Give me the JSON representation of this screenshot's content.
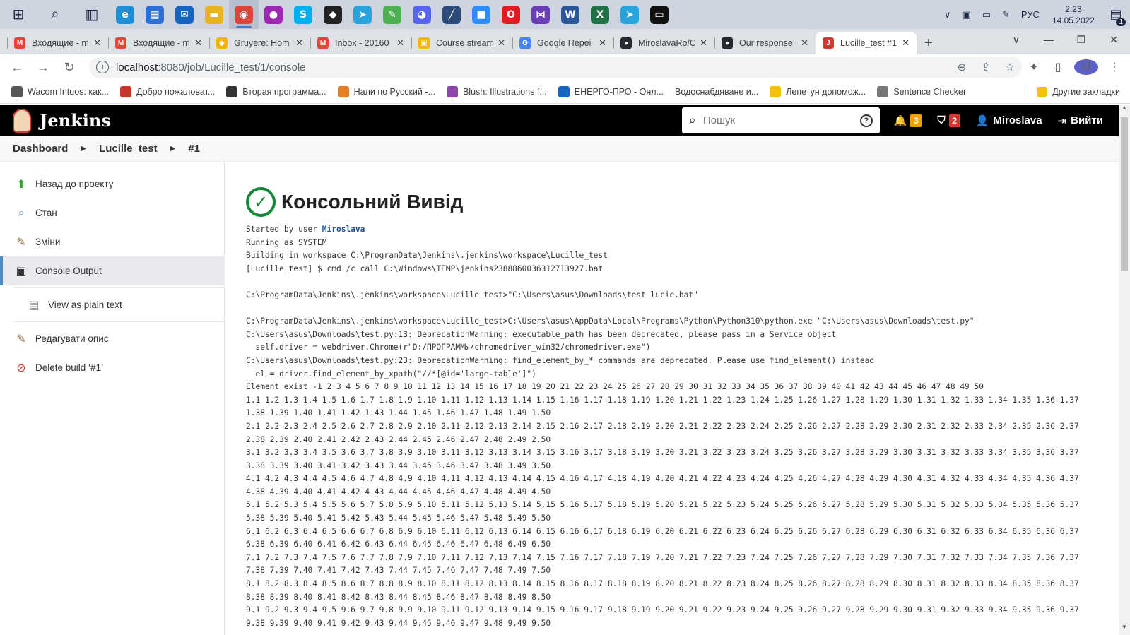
{
  "taskbar": {
    "lang": "РУС",
    "time": "2:23",
    "date": "14.05.2022",
    "notif_count": "1",
    "apps": [
      {
        "name": "edge-icon",
        "glyph": "e",
        "color": "#1e8fd6"
      },
      {
        "name": "store-icon",
        "glyph": "▦",
        "color": "#2d6fd6"
      },
      {
        "name": "mail-icon",
        "glyph": "✉",
        "color": "#1565c0"
      },
      {
        "name": "explorer-icon",
        "glyph": "▬",
        "color": "#e8b320"
      },
      {
        "name": "chrome-icon",
        "glyph": "◉",
        "color": "#db4437"
      },
      {
        "name": "paint-icon",
        "glyph": "●",
        "color": "#9c27b0"
      },
      {
        "name": "skype-icon",
        "glyph": "S",
        "color": "#00aff0"
      },
      {
        "name": "inkscape-icon",
        "glyph": "◆",
        "color": "#222222"
      },
      {
        "name": "telegram-icon",
        "glyph": "➤",
        "color": "#2aa3dc"
      },
      {
        "name": "sticky-icon",
        "glyph": "✎",
        "color": "#4caf50"
      },
      {
        "name": "discord-icon",
        "glyph": "◕",
        "color": "#5865f2"
      },
      {
        "name": "tool-icon",
        "glyph": "╱",
        "color": "#2b4a7a"
      },
      {
        "name": "zoom-icon",
        "glyph": "■",
        "color": "#2d8cff"
      },
      {
        "name": "opera-icon",
        "glyph": "O",
        "color": "#e11b22"
      },
      {
        "name": "visualstudio-icon",
        "glyph": "⋈",
        "color": "#6a3fb6"
      },
      {
        "name": "word-icon",
        "glyph": "W",
        "color": "#2b579a"
      },
      {
        "name": "excel-icon",
        "glyph": "X",
        "color": "#217346"
      },
      {
        "name": "telegram2-icon",
        "glyph": "➤",
        "color": "#2aa3dc"
      },
      {
        "name": "terminal-icon",
        "glyph": "▭",
        "color": "#111111"
      }
    ]
  },
  "tabs": [
    {
      "title": "Входящие - m",
      "fav": "M",
      "color": "#ea4335"
    },
    {
      "title": "Входящие - m",
      "fav": "M",
      "color": "#ea4335"
    },
    {
      "title": "Gruyere: Hom",
      "fav": "◆",
      "color": "#f4b400"
    },
    {
      "title": "Inbox - 20160",
      "fav": "M",
      "color": "#ea4335"
    },
    {
      "title": "Course stream",
      "fav": "▣",
      "color": "#f4b400"
    },
    {
      "title": "Google Переі",
      "fav": "G",
      "color": "#4285f4"
    },
    {
      "title": "MiroslavaRo/C",
      "fav": "●",
      "color": "#24292f"
    },
    {
      "title": "Our response",
      "fav": "●",
      "color": "#24292f"
    },
    {
      "title": "Lucille_test #1",
      "fav": "J",
      "color": "#d33833",
      "active": true
    }
  ],
  "address": {
    "host": "localhost",
    "path": ":8080/job/Lucille_test/1/console"
  },
  "bookmarks": [
    {
      "label": "Wacom Intuos: как...",
      "color": "#555"
    },
    {
      "label": "Добро пожаловат...",
      "color": "#c0392b"
    },
    {
      "label": "Вторая программа...",
      "color": "#333"
    },
    {
      "label": "Нали по Русский -...",
      "color": "#e67e22"
    },
    {
      "label": "Blush: Illustrations f...",
      "color": "#8e44ad"
    },
    {
      "label": "ЕНЕРГО-ПРО - Онл...",
      "color": "#1565c0"
    },
    {
      "label": "Водоснабдяване и...",
      "color": ""
    },
    {
      "label": "Лепетун допомож...",
      "color": "#f4c20d"
    },
    {
      "label": "Sentence Checker",
      "color": "#777"
    }
  ],
  "bookmarks_other": "Другие закладки",
  "jenkins": {
    "brand": "Jenkins",
    "search_placeholder": "Пошук",
    "notifications": "3",
    "security": "2",
    "user": "Miroslava",
    "logout": "Вийти"
  },
  "breadcrumb": [
    "Dashboard",
    "Lucille_test",
    "#1"
  ],
  "sidebar": [
    {
      "label": "Назад до проекту",
      "icon": "up-arrow-icon",
      "glyph": "⬆",
      "color": "#3a9b3a"
    },
    {
      "label": "Стан",
      "icon": "magnifier-icon",
      "glyph": "🔍",
      "color": "#5a7fa8"
    },
    {
      "label": "Зміни",
      "icon": "notepad-icon",
      "glyph": "📝",
      "color": "#8a6d3b"
    },
    {
      "label": "Console Output",
      "icon": "terminal-icon",
      "glyph": "▣",
      "color": "#333"
    },
    {
      "label": "View as plain text",
      "icon": "document-icon",
      "glyph": "▤",
      "color": "#999"
    },
    {
      "label": "Редагувати опис",
      "icon": "notepad-icon",
      "glyph": "📝",
      "color": "#8a6d3b"
    },
    {
      "label": "Delete build ‘#1’",
      "icon": "no-entry-icon",
      "glyph": "⊘",
      "color": "#d33833"
    }
  ],
  "page_title": "Консольний Вивід",
  "console": {
    "started_prefix": "Started by user ",
    "started_user": "Miroslava",
    "lines": [
      "Running as SYSTEM",
      "Building in workspace C:\\ProgramData\\Jenkins\\.jenkins\\workspace\\Lucille_test",
      "[Lucille_test] $ cmd /c call C:\\Windows\\TEMP\\jenkins2388860036312713927.bat",
      "",
      "C:\\ProgramData\\Jenkins\\.jenkins\\workspace\\Lucille_test>\"C:\\Users\\asus\\Downloads\\test_lucie.bat\"",
      "",
      "C:\\ProgramData\\Jenkins\\.jenkins\\workspace\\Lucille_test>C:\\Users\\asus\\AppData\\Local\\Programs\\Python\\Python310\\python.exe \"C:\\Users\\asus\\Downloads\\test.py\"",
      "C:\\Users\\asus\\Downloads\\test.py:13: DeprecationWarning: executable_path has been deprecated, please pass in a Service object",
      "  self.driver = webdriver.Chrome(r\"D:/ПРОГРАММЫ/chromedriver_win32/chromedriver.exe\")",
      "C:\\Users\\asus\\Downloads\\test.py:23: DeprecationWarning: find_element_by_* commands are deprecated. Please use find_element() instead",
      "  el = driver.find_element_by_xpath(\"//*[@id='large-table']\")",
      "Element exist -1 2 3 4 5 6 7 8 9 10 11 12 13 14 15 16 17 18 19 20 21 22 23 24 25 26 27 28 29 30 31 32 33 34 35 36 37 38 39 40 41 42 43 44 45 46 47 48 49 50",
      "1.1 1.2 1.3 1.4 1.5 1.6 1.7 1.8 1.9 1.10 1.11 1.12 1.13 1.14 1.15 1.16 1.17 1.18 1.19 1.20 1.21 1.22 1.23 1.24 1.25 1.26 1.27 1.28 1.29 1.30 1.31 1.32 1.33 1.34 1.35 1.36 1.37",
      "1.38 1.39 1.40 1.41 1.42 1.43 1.44 1.45 1.46 1.47 1.48 1.49 1.50",
      "2.1 2.2 2.3 2.4 2.5 2.6 2.7 2.8 2.9 2.10 2.11 2.12 2.13 2.14 2.15 2.16 2.17 2.18 2.19 2.20 2.21 2.22 2.23 2.24 2.25 2.26 2.27 2.28 2.29 2.30 2.31 2.32 2.33 2.34 2.35 2.36 2.37",
      "2.38 2.39 2.40 2.41 2.42 2.43 2.44 2.45 2.46 2.47 2.48 2.49 2.50",
      "3.1 3.2 3.3 3.4 3.5 3.6 3.7 3.8 3.9 3.10 3.11 3.12 3.13 3.14 3.15 3.16 3.17 3.18 3.19 3.20 3.21 3.22 3.23 3.24 3.25 3.26 3.27 3.28 3.29 3.30 3.31 3.32 3.33 3.34 3.35 3.36 3.37",
      "3.38 3.39 3.40 3.41 3.42 3.43 3.44 3.45 3.46 3.47 3.48 3.49 3.50",
      "4.1 4.2 4.3 4.4 4.5 4.6 4.7 4.8 4.9 4.10 4.11 4.12 4.13 4.14 4.15 4.16 4.17 4.18 4.19 4.20 4.21 4.22 4.23 4.24 4.25 4.26 4.27 4.28 4.29 4.30 4.31 4.32 4.33 4.34 4.35 4.36 4.37",
      "4.38 4.39 4.40 4.41 4.42 4.43 4.44 4.45 4.46 4.47 4.48 4.49 4.50",
      "5.1 5.2 5.3 5.4 5.5 5.6 5.7 5.8 5.9 5.10 5.11 5.12 5.13 5.14 5.15 5.16 5.17 5.18 5.19 5.20 5.21 5.22 5.23 5.24 5.25 5.26 5.27 5.28 5.29 5.30 5.31 5.32 5.33 5.34 5.35 5.36 5.37",
      "5.38 5.39 5.40 5.41 5.42 5.43 5.44 5.45 5.46 5.47 5.48 5.49 5.50",
      "6.1 6.2 6.3 6.4 6.5 6.6 6.7 6.8 6.9 6.10 6.11 6.12 6.13 6.14 6.15 6.16 6.17 6.18 6.19 6.20 6.21 6.22 6.23 6.24 6.25 6.26 6.27 6.28 6.29 6.30 6.31 6.32 6.33 6.34 6.35 6.36 6.37",
      "6.38 6.39 6.40 6.41 6.42 6.43 6.44 6.45 6.46 6.47 6.48 6.49 6.50",
      "7.1 7.2 7.3 7.4 7.5 7.6 7.7 7.8 7.9 7.10 7.11 7.12 7.13 7.14 7.15 7.16 7.17 7.18 7.19 7.20 7.21 7.22 7.23 7.24 7.25 7.26 7.27 7.28 7.29 7.30 7.31 7.32 7.33 7.34 7.35 7.36 7.37",
      "7.38 7.39 7.40 7.41 7.42 7.43 7.44 7.45 7.46 7.47 7.48 7.49 7.50",
      "8.1 8.2 8.3 8.4 8.5 8.6 8.7 8.8 8.9 8.10 8.11 8.12 8.13 8.14 8.15 8.16 8.17 8.18 8.19 8.20 8.21 8.22 8.23 8.24 8.25 8.26 8.27 8.28 8.29 8.30 8.31 8.32 8.33 8.34 8.35 8.36 8.37",
      "8.38 8.39 8.40 8.41 8.42 8.43 8.44 8.45 8.46 8.47 8.48 8.49 8.50",
      "9.1 9.2 9.3 9.4 9.5 9.6 9.7 9.8 9.9 9.10 9.11 9.12 9.13 9.14 9.15 9.16 9.17 9.18 9.19 9.20 9.21 9.22 9.23 9.24 9.25 9.26 9.27 9.28 9.29 9.30 9.31 9.32 9.33 9.34 9.35 9.36 9.37",
      "9.38 9.39 9.40 9.41 9.42 9.43 9.44 9.45 9.46 9.47 9.48 9.49 9.50"
    ]
  }
}
